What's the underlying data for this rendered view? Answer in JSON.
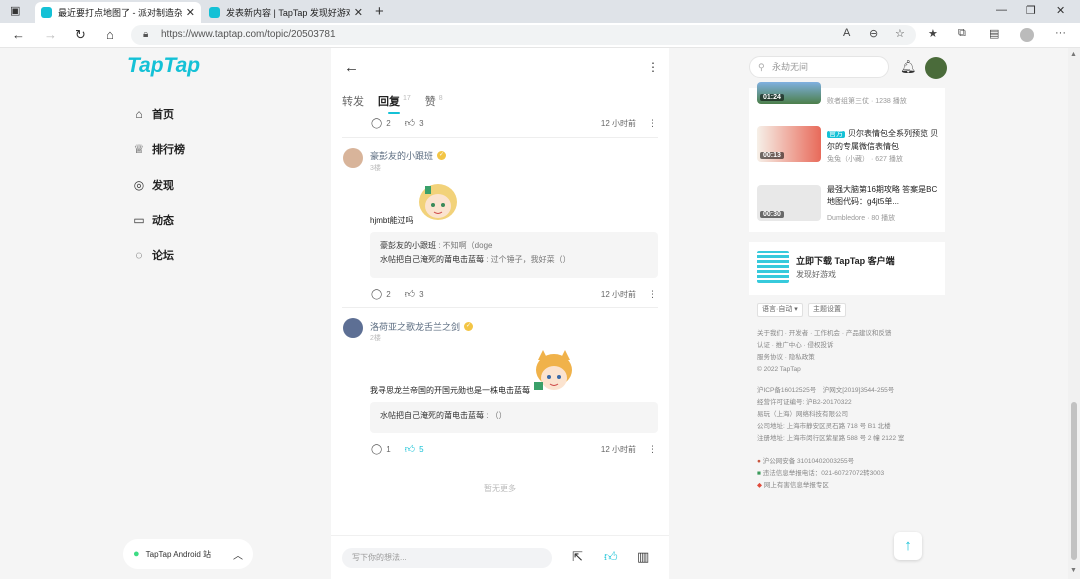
{
  "browser": {
    "tabs": [
      {
        "title": "最近要打点地图了 - 派对制造杂谈",
        "active": true
      },
      {
        "title": "发表新内容 | TapTap 发现好游戏",
        "active": false
      }
    ],
    "url": "https://www.taptap.com/topic/20503781"
  },
  "site": {
    "logo": "TapTap",
    "nav": [
      {
        "label": "首页",
        "icon": "home-icon"
      },
      {
        "label": "排行榜",
        "icon": "trophy-icon"
      },
      {
        "label": "发现",
        "icon": "compass-icon"
      },
      {
        "label": "动态",
        "icon": "chat-icon"
      },
      {
        "label": "论坛",
        "icon": "forum-icon"
      }
    ],
    "app_download": "TapTap Android 站"
  },
  "thread": {
    "tabs": [
      {
        "label": "转发",
        "count": ""
      },
      {
        "label": "回复",
        "count": "17"
      },
      {
        "label": "赞",
        "count": "8"
      }
    ],
    "top_actions": {
      "replies": "2",
      "likes": "3",
      "time": "12 小时前"
    },
    "comments": [
      {
        "name": "豪彭友的小跟班",
        "floor": "3楼",
        "text": "hjmbt能过吗",
        "replies": [
          {
            "user": "豪彭友的小跟班",
            "text": "不知啊（doge"
          },
          {
            "user": "水帖把自己淹死的莆电击蓝莓",
            "text": "过个锤子，我好菜（）"
          }
        ],
        "reply_count": "2",
        "like_count": "3",
        "liked": false,
        "time": "12 小时前"
      },
      {
        "name": "洛荷亚之歌龙舌兰之剑",
        "floor": "2楼",
        "text": "我寻思龙兰帝国的开国元勋也是一株电击蓝莓",
        "replies": [
          {
            "user": "水帖把自己淹死的莆电击蓝莓",
            "text": "（）"
          }
        ],
        "reply_count": "1",
        "like_count": "5",
        "liked": true,
        "time": "12 小时前"
      }
    ],
    "no_more": "暂无更多",
    "composer_placeholder": "写下你的想法..."
  },
  "sidebar": {
    "search_placeholder": "永劫无间",
    "videos": [
      {
        "title": "",
        "meta": "败者组第三仗 · 1238 播放",
        "duration": "01:24",
        "tag": ""
      },
      {
        "title": "贝尔表情包全系列预览 贝尔的专属微信表情包",
        "meta": "兔兔（小藏） · 627 播放",
        "duration": "00:13",
        "tag": "官方"
      },
      {
        "title": "最强大脑第16期攻略 答案是BC地图代码：g4jt5单...",
        "meta": "Dumbledore · 80 播放",
        "duration": "00:30",
        "tag": ""
      }
    ],
    "download": {
      "title": "立即下载 TapTap 客户端",
      "sub": "发现好游戏"
    },
    "pills": [
      "语言·自动 ▾",
      "主题设置"
    ],
    "footer_links": [
      "关于我们 · 开发者 · 工作机会 · 产品建议和反馈",
      "认证 · 推广中心 · 侵权投诉",
      "服务协议 · 隐私政策",
      "© 2022 TapTap"
    ],
    "footer_legal": [
      "沪ICP备16012525号　沪网文[2019]3544-255号",
      "经营许可证编号: 沪B2-20170322",
      "易玩（上海）网络科技有限公司",
      "公司地址: 上海市静安区灵石路 718 号 B1 北楼",
      "注册地址: 上海市闵行区紫星路 588 号 2 幢 2122 室"
    ],
    "footer_police": [
      "沪公网安备 31010402003255号",
      "违法信息举报电话：021-60727072转3003",
      "网上有害信息举报专区"
    ]
  },
  "colors": {
    "accent": "#14c1d6",
    "background": "#f5f5f5"
  }
}
